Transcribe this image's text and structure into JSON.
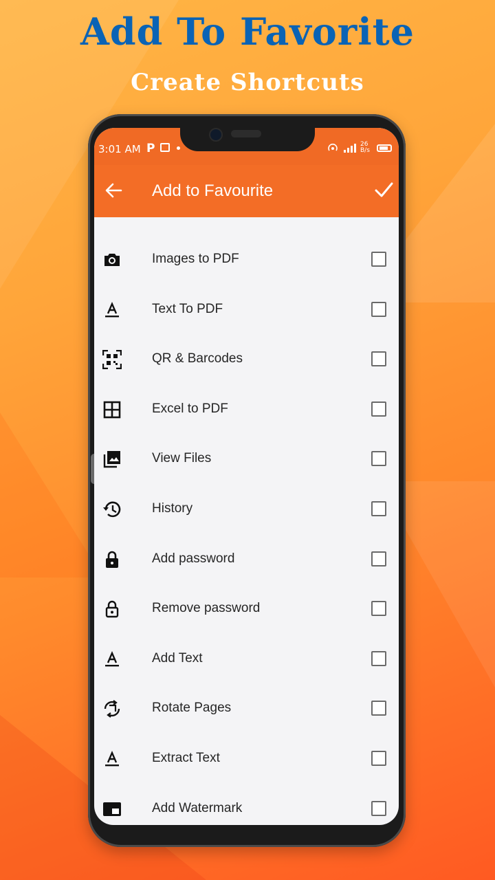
{
  "promo": {
    "headline": "Add To Favorite",
    "subheadline": "Create Shortcuts"
  },
  "statusbar": {
    "time": "3:01 AM",
    "indicator": "P",
    "speed": "26 B/s",
    "icons": [
      "image-icon",
      "dot-icon",
      "hotspot-icon",
      "signal-icon",
      "battery-icon"
    ]
  },
  "appbar": {
    "back_icon": "arrow-left-icon",
    "title": "Add to Favourite",
    "confirm_icon": "check-icon"
  },
  "items": [
    {
      "label": "Images to PDF",
      "icon": "camera-icon",
      "checked": false
    },
    {
      "label": "Text To PDF",
      "icon": "text-format-icon",
      "checked": false
    },
    {
      "label": "QR & Barcodes",
      "icon": "qr-scan-icon",
      "checked": false
    },
    {
      "label": "Excel to PDF",
      "icon": "grid-icon",
      "checked": false
    },
    {
      "label": "View Files",
      "icon": "image-library-icon",
      "checked": false
    },
    {
      "label": "History",
      "icon": "history-icon",
      "checked": false
    },
    {
      "label": "Add password",
      "icon": "lock-icon",
      "checked": false
    },
    {
      "label": "Remove password",
      "icon": "unlock-icon",
      "checked": false
    },
    {
      "label": "Add Text",
      "icon": "text-format-icon",
      "checked": false
    },
    {
      "label": "Rotate Pages",
      "icon": "rotate-icon",
      "checked": false
    },
    {
      "label": "Extract Text",
      "icon": "text-format-icon",
      "checked": false
    },
    {
      "label": "Add Watermark",
      "icon": "watermark-icon",
      "checked": false
    }
  ],
  "colors": {
    "appbar": "#f36d26",
    "headline": "#0a63b5",
    "background": "#ff9a30"
  }
}
